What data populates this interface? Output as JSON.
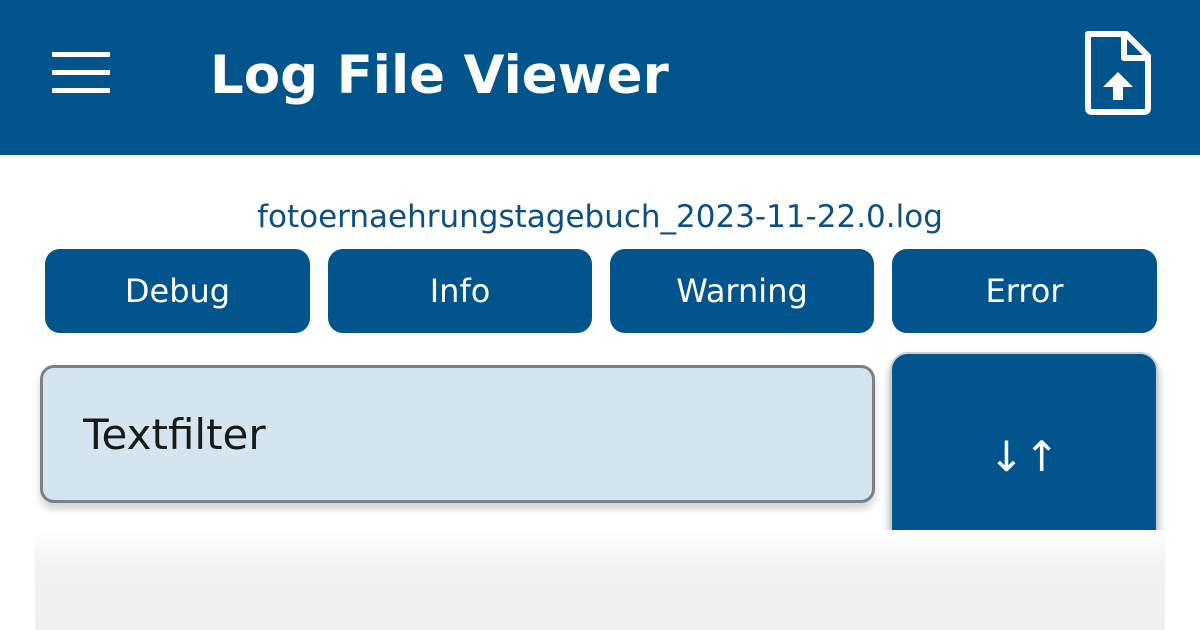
{
  "header": {
    "title": "Log File Viewer",
    "menu_icon": "menu-icon",
    "upload_icon": "file-upload-icon"
  },
  "file": {
    "name": "fotoernaehrungstagebuch_2023-11-22.0.log"
  },
  "levels": [
    {
      "label": "Debug"
    },
    {
      "label": "Info"
    },
    {
      "label": "Warning"
    },
    {
      "label": "Error"
    }
  ],
  "filter": {
    "placeholder": "Textfilter",
    "value": ""
  },
  "sort": {
    "label": "↓↑"
  },
  "colors": {
    "primary": "#01548c",
    "input_background": "#d4e5f0",
    "on_primary": "#ffffff"
  }
}
